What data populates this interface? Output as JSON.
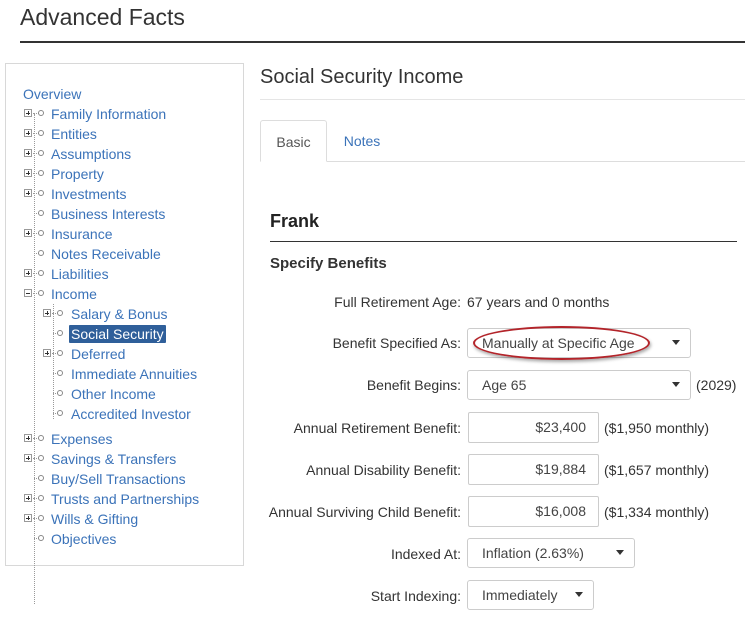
{
  "app": {
    "title": "Advanced Facts"
  },
  "sidebar": {
    "items": [
      {
        "label": "Overview"
      },
      {
        "label": "Family Information"
      },
      {
        "label": "Entities"
      },
      {
        "label": "Assumptions"
      },
      {
        "label": "Property"
      },
      {
        "label": "Investments"
      },
      {
        "label": "Business Interests"
      },
      {
        "label": "Insurance"
      },
      {
        "label": "Notes Receivable"
      },
      {
        "label": "Liabilities"
      },
      {
        "label": "Income"
      },
      {
        "label": "Salary & Bonus"
      },
      {
        "label": "Social Security"
      },
      {
        "label": "Deferred"
      },
      {
        "label": "Immediate Annuities"
      },
      {
        "label": "Other Income"
      },
      {
        "label": "Accredited Investor"
      },
      {
        "label": "Expenses"
      },
      {
        "label": "Savings & Transfers"
      },
      {
        "label": "Buy/Sell Transactions"
      },
      {
        "label": "Trusts and Partnerships"
      },
      {
        "label": "Wills & Gifting"
      },
      {
        "label": "Objectives"
      }
    ]
  },
  "main": {
    "title": "Social Security Income",
    "tabs": [
      {
        "label": "Basic"
      },
      {
        "label": "Notes"
      }
    ],
    "person": "Frank",
    "subsection": "Specify Benefits",
    "fields": {
      "full_retirement_age": {
        "label": "Full Retirement Age:",
        "value": "67 years and 0 months"
      },
      "benefit_specified_as": {
        "label": "Benefit Specified As:",
        "value": "Manually at Specific Age"
      },
      "benefit_begins": {
        "label": "Benefit Begins:",
        "value": "Age 65",
        "note": "(2029)"
      },
      "annual_retirement_benefit": {
        "label": "Annual Retirement Benefit:",
        "value": "$23,400",
        "note": "($1,950 monthly)"
      },
      "annual_disability_benefit": {
        "label": "Annual Disability Benefit:",
        "value": "$19,884",
        "note": "($1,657 monthly)"
      },
      "annual_surviving_child_benefit": {
        "label": "Annual Surviving Child Benefit:",
        "value": "$16,008",
        "note": "($1,334 monthly)"
      },
      "indexed_at": {
        "label": "Indexed At:",
        "value": "Inflation (2.63%)"
      },
      "start_indexing": {
        "label": "Start Indexing:",
        "value": "Immediately"
      }
    }
  },
  "colors": {
    "link": "#3b73b9",
    "selected_bg": "#2f5f9a",
    "highlight": "#b3242a"
  }
}
